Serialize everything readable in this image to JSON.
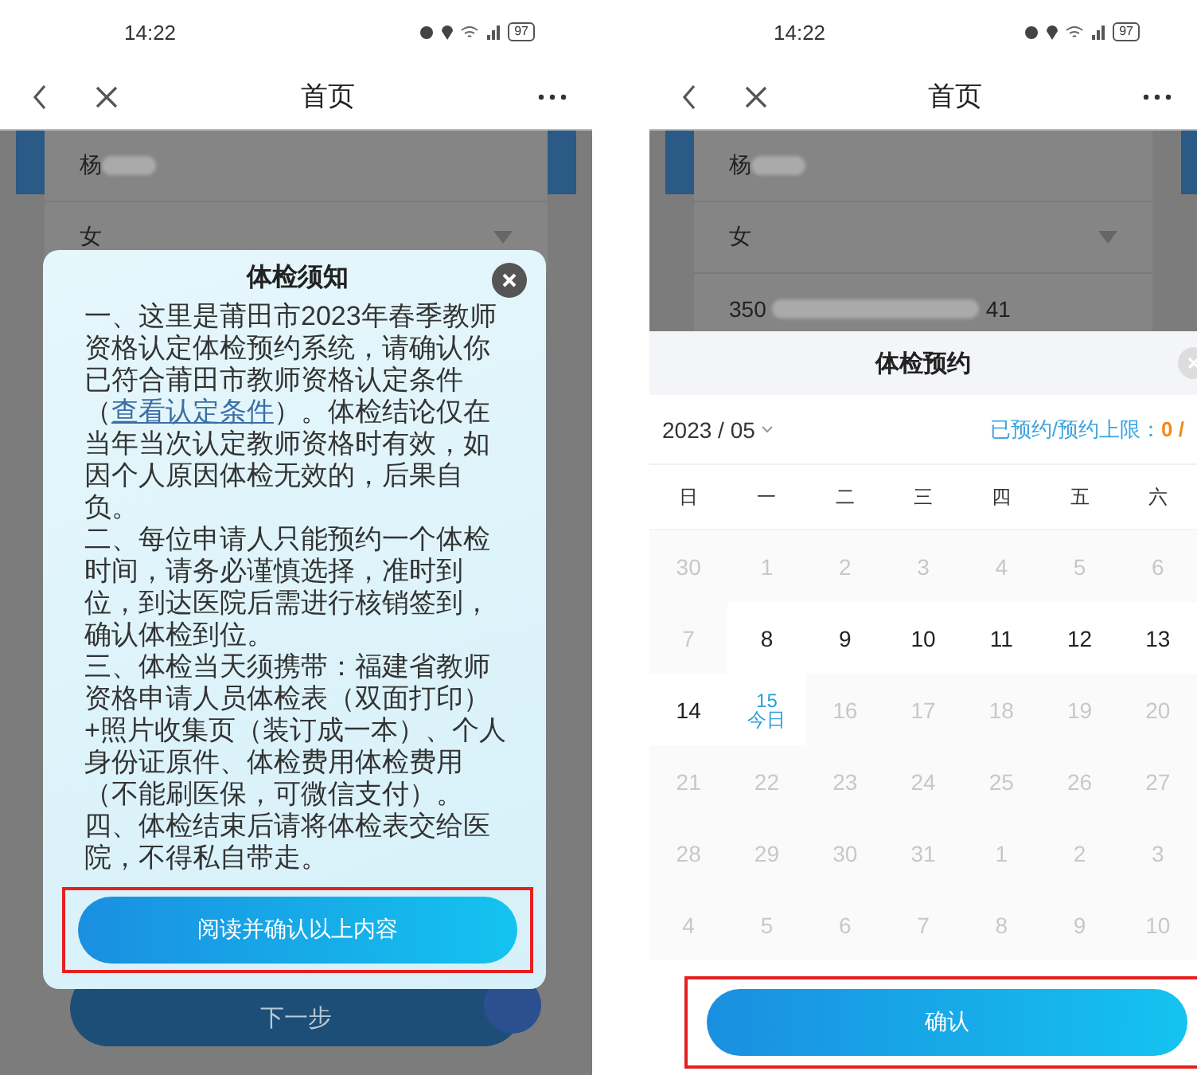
{
  "left_screen": {
    "status_bar": {
      "time": "14:22",
      "battery": "97"
    },
    "nav": {
      "title": "首页"
    },
    "form_fields": [
      {
        "value": "杨",
        "redacted": true,
        "kind": "text"
      },
      {
        "value": "女",
        "redacted": false,
        "kind": "select"
      }
    ],
    "next_button": {
      "label": "下一步"
    },
    "notice_dialog": {
      "title": "体检须知",
      "paragraphs": [
        {
          "before": "一、这里是莆田市2023年春季教师资格认定体检预约系统，请确认你已符合莆田市教师资格认定条件（",
          "link": "查看认定条件",
          "after": "）。体检结论仅在当年当次认定教师资格时有效，如因个人原因体检无效的，后果自负。"
        },
        {
          "before": "二、每位申请人只能预约一个体检时间，请务必谨慎选择，准时到位，到达医院后需进行核销签到，确认体检到位。"
        },
        {
          "before": "三、体检当天须携带：福建省教师资格申请人员体检表（双面打印）+照片收集页（装订成一本）、个人身份证原件、体检费用体检费用（不能刷医保，可微信支付）。"
        },
        {
          "before": "四、体检结束后请将体检表交给医院，不得私自带走。"
        }
      ],
      "confirm_button": {
        "label": "阅读并确认以上内容",
        "highlighted": true
      }
    }
  },
  "right_screen": {
    "status_bar": {
      "time": "14:22",
      "battery": "97"
    },
    "nav": {
      "title": "首页"
    },
    "form_fields": [
      {
        "value": "杨",
        "redacted": true,
        "kind": "text"
      },
      {
        "value": "女",
        "redacted": false,
        "kind": "select"
      },
      {
        "value": "350",
        "redacted": true,
        "value_end": "41",
        "kind": "text"
      }
    ],
    "booking_sheet": {
      "title": "体检预约",
      "month": "2023 / 05",
      "quota_label": "已预约/预约上限：",
      "quota_value": "0 /",
      "weekdays": [
        "日",
        "一",
        "二",
        "三",
        "四",
        "五",
        "六"
      ],
      "weeks": [
        [
          {
            "day": "30",
            "kind": "disabled"
          },
          {
            "day": "1",
            "kind": "disabled"
          },
          {
            "day": "2",
            "kind": "disabled"
          },
          {
            "day": "3",
            "kind": "disabled"
          },
          {
            "day": "4",
            "kind": "disabled"
          },
          {
            "day": "5",
            "kind": "disabled"
          },
          {
            "day": "6",
            "kind": "disabled"
          }
        ],
        [
          {
            "day": "7",
            "kind": "disabled"
          },
          {
            "day": "8",
            "kind": "available"
          },
          {
            "day": "9",
            "kind": "available"
          },
          {
            "day": "10",
            "kind": "available"
          },
          {
            "day": "11",
            "kind": "available"
          },
          {
            "day": "12",
            "kind": "available"
          },
          {
            "day": "13",
            "kind": "available"
          }
        ],
        [
          {
            "day": "14",
            "kind": "available"
          },
          {
            "day": "15",
            "kind": "today",
            "note": "今日"
          },
          {
            "day": "16",
            "kind": "disabled"
          },
          {
            "day": "17",
            "kind": "disabled"
          },
          {
            "day": "18",
            "kind": "disabled"
          },
          {
            "day": "19",
            "kind": "disabled"
          },
          {
            "day": "20",
            "kind": "disabled"
          }
        ],
        [
          {
            "day": "21",
            "kind": "disabled"
          },
          {
            "day": "22",
            "kind": "disabled"
          },
          {
            "day": "23",
            "kind": "disabled"
          },
          {
            "day": "24",
            "kind": "disabled"
          },
          {
            "day": "25",
            "kind": "disabled"
          },
          {
            "day": "26",
            "kind": "disabled"
          },
          {
            "day": "27",
            "kind": "disabled"
          }
        ],
        [
          {
            "day": "28",
            "kind": "disabled"
          },
          {
            "day": "29",
            "kind": "disabled"
          },
          {
            "day": "30",
            "kind": "disabled"
          },
          {
            "day": "31",
            "kind": "disabled"
          },
          {
            "day": "1",
            "kind": "disabled"
          },
          {
            "day": "2",
            "kind": "disabled"
          },
          {
            "day": "3",
            "kind": "disabled"
          }
        ],
        [
          {
            "day": "4",
            "kind": "disabled"
          },
          {
            "day": "5",
            "kind": "disabled"
          },
          {
            "day": "6",
            "kind": "disabled"
          },
          {
            "day": "7",
            "kind": "disabled"
          },
          {
            "day": "8",
            "kind": "disabled"
          },
          {
            "day": "9",
            "kind": "disabled"
          },
          {
            "day": "10",
            "kind": "disabled"
          }
        ]
      ],
      "confirm_button": {
        "label": "确认",
        "highlighted": true
      }
    }
  }
}
